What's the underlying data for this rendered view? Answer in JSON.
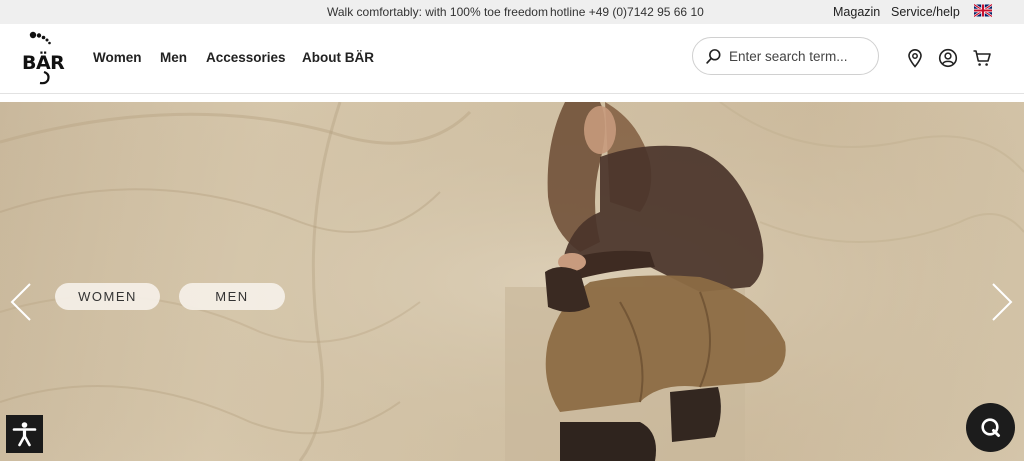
{
  "topbar": {
    "promo": "Walk comfortably: with 100% toe freedom",
    "hotline": "hotline +49 (0)7142 95 66 10",
    "magazin": "Magazin",
    "service": "Service/help",
    "language_icon": "uk-flag-icon"
  },
  "header": {
    "logo_text": "BÄR",
    "nav": [
      {
        "label": "Women"
      },
      {
        "label": "Men"
      },
      {
        "label": "Accessories"
      },
      {
        "label": "About BÄR"
      }
    ],
    "search": {
      "placeholder": "Enter search term...",
      "value": ""
    },
    "icons": [
      "search-icon",
      "location-pin-icon",
      "account-icon",
      "cart-icon"
    ]
  },
  "hero": {
    "buttons": [
      {
        "label": "WOMEN"
      },
      {
        "label": "MEN"
      }
    ],
    "prev_icon": "chevron-left-icon",
    "next_icon": "chevron-right-icon"
  },
  "widgets": {
    "accessibility_icon": "accessibility-icon",
    "chat_icon": "chat-search-icon"
  },
  "colors": {
    "topbar_bg": "#efefef",
    "hero_tone": "#d2c2a6",
    "pill_bg": "#f5f0e8",
    "widget_dark": "#1a1a1a"
  }
}
